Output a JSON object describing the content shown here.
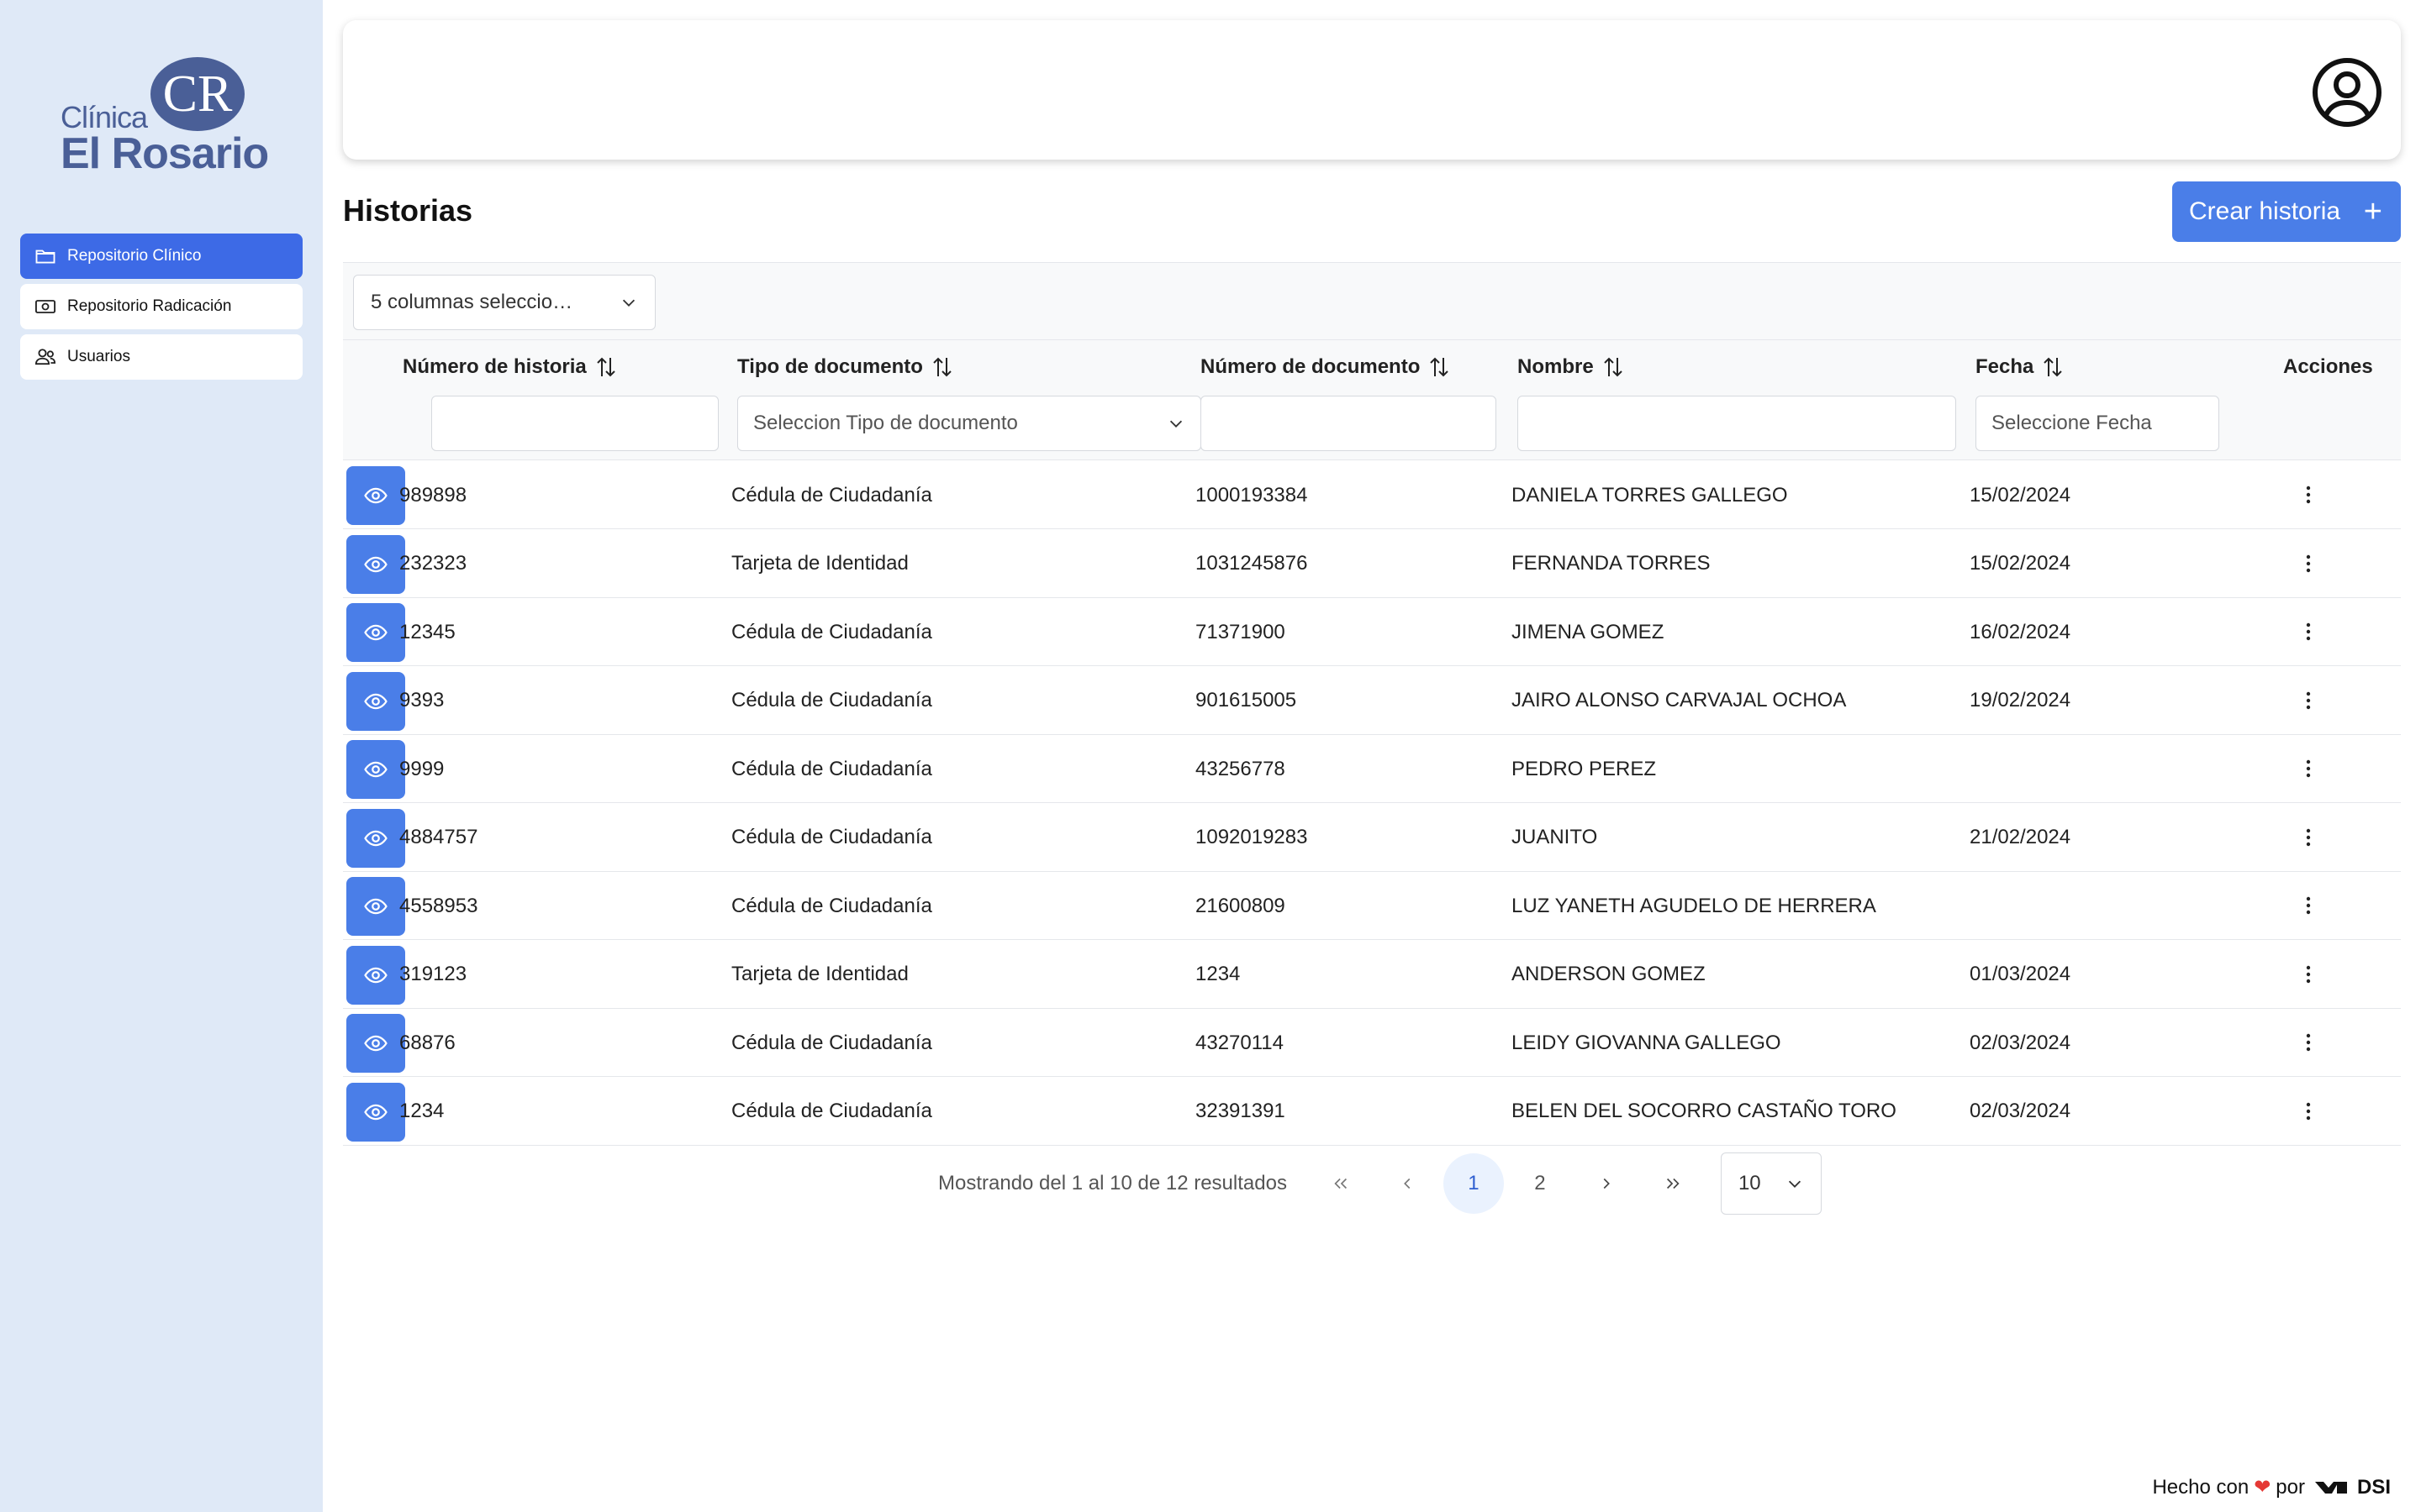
{
  "brand": {
    "logo_line1": "Clínica",
    "logo_line2": "El Rosario",
    "logo_mark": "CR",
    "colors": {
      "logo": "#4a5f97",
      "accent": "#3d6ae6",
      "sidebar_bg": "#dfe9f7"
    }
  },
  "sidebar": {
    "items": [
      {
        "label": "Repositorio Clínico",
        "icon": "folder-icon",
        "active": true
      },
      {
        "label": "Repositorio Radicación",
        "icon": "money-bill-icon",
        "active": false
      },
      {
        "label": "Usuarios",
        "icon": "users-icon",
        "active": false
      }
    ]
  },
  "topbar": {
    "avatar_icon": "user-circle-icon"
  },
  "header": {
    "title": "Historias",
    "create_button": "Crear historia",
    "create_icon": "plus-icon"
  },
  "toolbar": {
    "columns_select": "5 columnas seleccio…"
  },
  "table": {
    "columns": [
      {
        "label": "Número de historia",
        "sortable": true
      },
      {
        "label": "Tipo de documento",
        "sortable": true
      },
      {
        "label": "Número de documento",
        "sortable": true
      },
      {
        "label": "Nombre",
        "sortable": true
      },
      {
        "label": "Fecha",
        "sortable": true
      },
      {
        "label": "Acciones",
        "sortable": false
      }
    ],
    "filters": {
      "historia": "",
      "tipo_placeholder": "Seleccion Tipo de documento",
      "numero": "",
      "nombre": "",
      "fecha_placeholder": "Seleccione Fecha"
    },
    "rows": [
      {
        "historia": "989898",
        "tipo": "Cédula de Ciudadanía",
        "numero": "1000193384",
        "nombre": "DANIELA TORRES GALLEGO",
        "fecha": "15/02/2024"
      },
      {
        "historia": "232323",
        "tipo": "Tarjeta de Identidad",
        "numero": "1031245876",
        "nombre": "FERNANDA TORRES",
        "fecha": "15/02/2024"
      },
      {
        "historia": "12345",
        "tipo": "Cédula de Ciudadanía",
        "numero": "71371900",
        "nombre": "JIMENA GOMEZ",
        "fecha": "16/02/2024"
      },
      {
        "historia": "9393",
        "tipo": "Cédula de Ciudadanía",
        "numero": "901615005",
        "nombre": "JAIRO ALONSO CARVAJAL OCHOA",
        "fecha": "19/02/2024"
      },
      {
        "historia": "9999",
        "tipo": "Cédula de Ciudadanía",
        "numero": "43256778",
        "nombre": "PEDRO PEREZ",
        "fecha": ""
      },
      {
        "historia": "4884757",
        "tipo": "Cédula de Ciudadanía",
        "numero": "1092019283",
        "nombre": "JUANITO",
        "fecha": "21/02/2024"
      },
      {
        "historia": "4558953",
        "tipo": "Cédula de Ciudadanía",
        "numero": "21600809",
        "nombre": "LUZ YANETH AGUDELO DE HERRERA",
        "fecha": ""
      },
      {
        "historia": "319123",
        "tipo": "Tarjeta de Identidad",
        "numero": "1234",
        "nombre": "ANDERSON GOMEZ",
        "fecha": "01/03/2024"
      },
      {
        "historia": "68876",
        "tipo": "Cédula de Ciudadanía",
        "numero": "43270114",
        "nombre": "LEIDY GIOVANNA GALLEGO",
        "fecha": "02/03/2024"
      },
      {
        "historia": "1234",
        "tipo": "Cédula de Ciudadanía",
        "numero": "32391391",
        "nombre": "BELEN DEL SOCORRO CASTAÑO TORO",
        "fecha": "02/03/2024"
      }
    ]
  },
  "pagination": {
    "summary": "Mostrando del 1 al 10 de 12 resultados",
    "pages": [
      "1",
      "2"
    ],
    "current_page": "1",
    "rows_per_page": "10"
  },
  "footer": {
    "text_before": "Hecho con",
    "text_after": "por",
    "brand": "DSI"
  }
}
